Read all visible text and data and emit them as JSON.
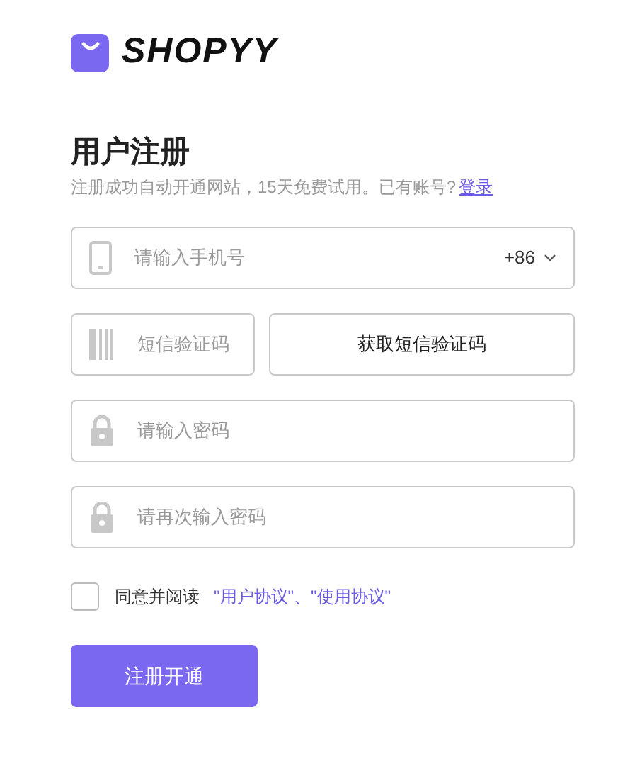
{
  "brand": {
    "name": "SHOPYY"
  },
  "heading": "用户注册",
  "subtitle": {
    "text": "注册成功自动开通网站，15天免费试用。已有账号?",
    "link": "登录"
  },
  "phone": {
    "placeholder": "请输入手机号",
    "country_code": "+86"
  },
  "sms": {
    "placeholder": "短信验证码",
    "button": "获取短信验证码"
  },
  "passwords": [
    {
      "placeholder": "请输入密码"
    },
    {
      "placeholder": "请再次输入密码"
    }
  ],
  "agreement": {
    "checked": false,
    "label": "同意并阅读",
    "links": [
      "\"用户协议\"",
      "\"使用协议\""
    ],
    "separator": "、"
  },
  "submit": "注册开通"
}
